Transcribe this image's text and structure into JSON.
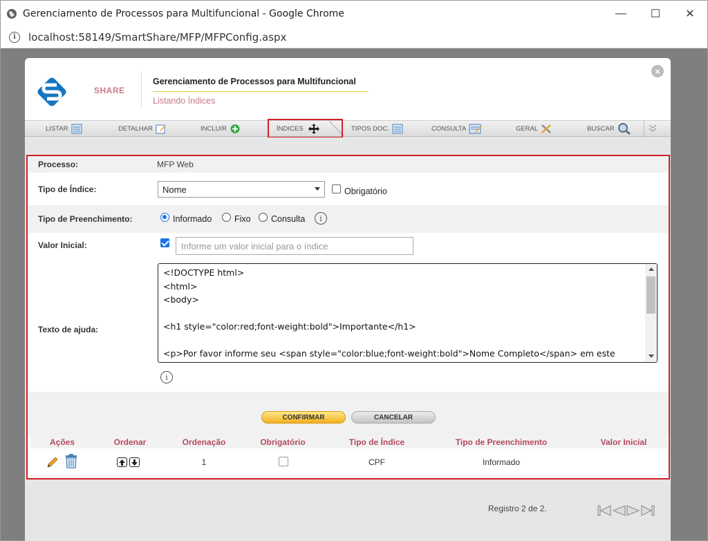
{
  "window": {
    "title": "Gerenciamento de Processos para Multifuncional - Google Chrome",
    "url": "localhost:58149/SmartShare/MFP/MFPConfig.aspx"
  },
  "header": {
    "brand": "SHARE",
    "app_title": "Gerenciamento de Processos para Multifuncional",
    "subtitle": "Listando Índices"
  },
  "toolbar": {
    "items": [
      {
        "label": "LISTAR",
        "icon": "list-icon"
      },
      {
        "label": "DETALHAR",
        "icon": "edit-icon"
      },
      {
        "label": "INCLUIR",
        "icon": "add-icon"
      },
      {
        "label": "ÍNDICES",
        "icon": "move-icon",
        "active": true
      },
      {
        "label": "TIPOS DOC.",
        "icon": "list-icon"
      },
      {
        "label": "CONSULTA",
        "icon": "query-icon"
      },
      {
        "label": "GERAL",
        "icon": "tools-icon"
      },
      {
        "label": "BUSCAR",
        "icon": "search-icon"
      }
    ]
  },
  "form": {
    "processo_label": "Processo:",
    "processo_value": "MFP Web",
    "tipo_indice_label": "Tipo de Índice:",
    "tipo_indice_value": "Nome",
    "obrigatorio_label": "Obrigatório",
    "tipo_preenchimento_label": "Tipo de Preenchimento:",
    "preenchimento_options": [
      "Informado",
      "Fixo",
      "Consulta"
    ],
    "preenchimento_selected": "Informado",
    "valor_inicial_label": "Valor Inicial:",
    "valor_inicial_placeholder": "Informe um valor inicial para o índice",
    "texto_ajuda_label": "Texto de ajuda:",
    "texto_ajuda_value": "<!DOCTYPE html>\n<html>\n<body>\n\n<h1 style=\"color:red;font-weight:bold\">Importante</h1>\n\n<p>Por favor informe seu <span style=\"color:blue;font-weight:bold\">Nome Completo</span> em este"
  },
  "buttons": {
    "confirm": "CONFIRMAR",
    "cancel": "CANCELAR"
  },
  "table": {
    "headers": [
      "Ações",
      "Ordenar",
      "Ordenação",
      "Obrigatório",
      "Tipo de Índice",
      "Tipo de Preenchimento",
      "Valor Inicial"
    ],
    "rows": [
      {
        "ordenacao": "1",
        "obrigatorio": false,
        "tipo_indice": "CPF",
        "tipo_preenchimento": "Informado",
        "valor_inicial": ""
      }
    ]
  },
  "footer": {
    "registro": "Registro 2 de 2."
  },
  "colors": {
    "highlight_red": "#d21f26",
    "header_accent": "#b44a5f",
    "confirm_gold": "#f2b01e"
  }
}
